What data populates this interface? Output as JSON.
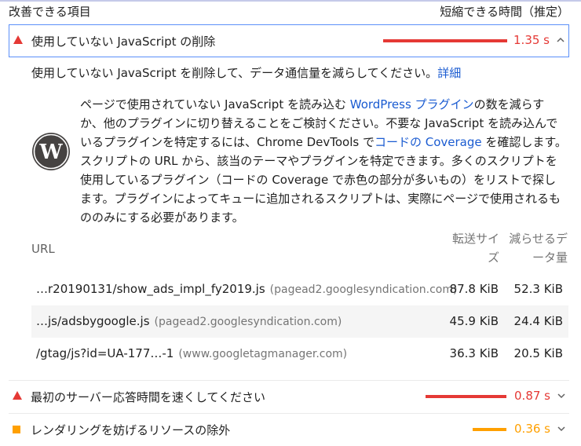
{
  "header": {
    "left": "改善できる項目",
    "right": "短縮できる時間（推定）"
  },
  "audits": [
    {
      "title": "使用していない JavaScript の削除",
      "value": "1.35 s",
      "status": "fail",
      "color": "#e53935",
      "expanded": true
    },
    {
      "title": "最初のサーバー応答時間を速くしてください",
      "value": "0.87 s",
      "status": "fail",
      "color": "#e53935",
      "expanded": false
    },
    {
      "title": "レンダリングを妨げるリソースの除外",
      "value": "0.36 s",
      "status": "average",
      "color": "#ffa000",
      "expanded": false
    }
  ],
  "detail": {
    "description": "使用していない JavaScript を削除して、データ通信量を減らしてください。",
    "learn_more": "詳細",
    "wp_text_1": "ページで使用されていない JavaScript を読み込む ",
    "wp_link_1": "WordPress プラグイン",
    "wp_text_2": "の数を減らすか、他のプラグインに切り替えることをご検討ください。不要な JavaScript を読み込んでいるプラグインを特定するには、Chrome DevTools で",
    "wp_link_2": "コードの Coverage",
    "wp_text_3": " を確認します。スクリプトの URL から、該当のテーマやプラグインを特定できます。多くのスクリプトを使用しているプラグイン（コードの Coverage で赤色の部分が多いもの）をリストで探します。プラグインによってキューに追加されるスクリプトは、実際にページで使用されるもののみにする必要があります。",
    "wp_logo_icon": "wordpress-logo"
  },
  "table": {
    "col_url": "URL",
    "col_transfer": "転送サイズ",
    "col_savings": "減らせるデータ量",
    "rows": [
      {
        "url": "…r20190131/show_ads_impl_fy2019.js",
        "host": "(pagead2.googlesyndication.com)",
        "transfer": "87.8 KiB",
        "savings": "52.3 KiB"
      },
      {
        "url": "…js/adsbygoogle.js",
        "host": "(pagead2.googlesyndication.com)",
        "transfer": "45.9 KiB",
        "savings": "24.4 KiB"
      },
      {
        "url": "/gtag/js?id=UA-177…-1",
        "host": "(www.googletagmanager.com)",
        "transfer": "36.3 KiB",
        "savings": "20.5 KiB"
      }
    ]
  },
  "colors": {
    "fail": "#e53935",
    "average": "#ffa000",
    "link": "#1a5bd1"
  }
}
